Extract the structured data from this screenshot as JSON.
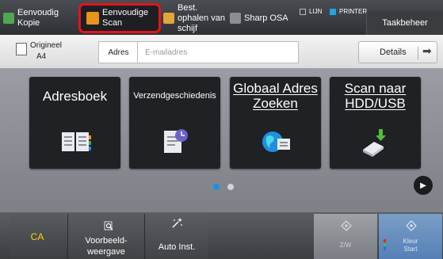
{
  "topbar": {
    "tabs": [
      {
        "label": "Eenvoudig Kopie",
        "active": false,
        "icon": "copier-icon"
      },
      {
        "label": "Eenvoudige Scan",
        "active": true,
        "icon": "scanner-icon"
      },
      {
        "label": "Best. ophalen van schijf",
        "active": false,
        "icon": "folder-icon"
      },
      {
        "label": "Sharp OSA",
        "active": false,
        "icon": "osa-icon"
      }
    ],
    "indicators": [
      {
        "label": "LIJN",
        "color": "#bbbbbb"
      },
      {
        "label": "PRINTER",
        "color": "#1fa5e0"
      }
    ],
    "job_status_label": "Taakbeheer"
  },
  "address_row": {
    "original_label": "Origineel",
    "original_size": "A4",
    "address_label": "Adres",
    "address_placeholder": "E-mailadres",
    "address_value": "",
    "details_label": "Details"
  },
  "tiles": [
    {
      "label": "Adresboek",
      "icon": "address-book-icon"
    },
    {
      "label": "Verzendgeschiedenis",
      "icon": "send-history-icon"
    },
    {
      "label": "Globaal Adres Zoeken",
      "icon": "global-search-icon"
    },
    {
      "label": "Scan naar HDD/USB",
      "icon": "usb-icon"
    }
  ],
  "pager": {
    "current": 1,
    "total": 2
  },
  "bottom": {
    "ca_label": "CA",
    "preview_label": "Voorbeeld-weergave",
    "auto_label": "Auto Inst.",
    "bw_label": "Z/W",
    "color_label_1": "Kleur",
    "color_label_2": "Start"
  },
  "colors": {
    "accent_active": "#e3141c",
    "ca_text": "#ffd200",
    "pager_active": "#1f8fde",
    "color_start": "#5680b6"
  }
}
